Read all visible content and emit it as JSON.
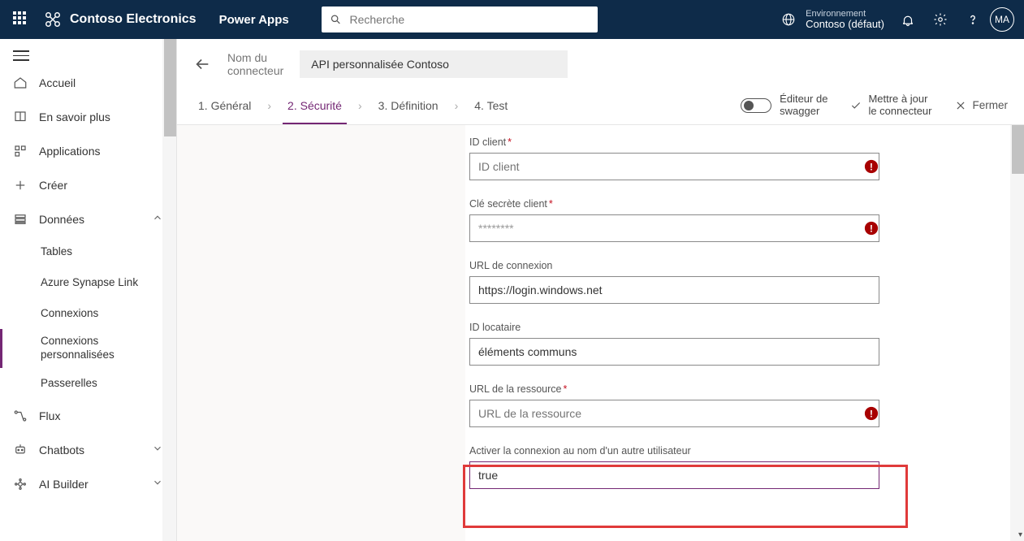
{
  "header": {
    "brand": "Contoso Electronics",
    "product": "Power Apps",
    "search_placeholder": "Recherche",
    "env_label": "Environnement",
    "env_value": "Contoso (défaut)",
    "avatar": "MA"
  },
  "sidebar": {
    "items": [
      {
        "label": "Accueil"
      },
      {
        "label": "En savoir plus"
      },
      {
        "label": "Applications"
      },
      {
        "label": "Créer"
      },
      {
        "label": "Données"
      },
      {
        "label": "Tables"
      },
      {
        "label": "Azure Synapse Link"
      },
      {
        "label": "Connexions"
      },
      {
        "label_line1": "Connexions",
        "label_line2": "personnalisées"
      },
      {
        "label": "Passerelles"
      },
      {
        "label": "Flux"
      },
      {
        "label": "Chatbots"
      },
      {
        "label": "AI Builder"
      }
    ]
  },
  "title": {
    "label_line1": "Nom du",
    "label_line2": "connecteur",
    "value": "API personnalisée Contoso"
  },
  "steps": {
    "s1": "1. Général",
    "s2": "2. Sécurité",
    "s3": "3. Définition",
    "s4": "4. Test",
    "swagger_line1": "Éditeur de",
    "swagger_line2": "swagger",
    "update_line1": "Mettre à jour",
    "update_line2": "le connecteur",
    "close": "Fermer"
  },
  "form": {
    "client_id_label": "ID client",
    "client_id_placeholder": "ID client",
    "client_secret_label": "Clé secrète client",
    "client_secret_value": "********",
    "login_url_label": "URL de connexion",
    "login_url_value": "https://login.windows.net",
    "tenant_id_label": "ID locataire",
    "tenant_id_value": "éléments communs",
    "resource_url_label": "URL de la ressource",
    "resource_url_placeholder": "URL de la ressource",
    "onbehalf_label": "Activer la connexion au nom d'un autre utilisateur",
    "onbehalf_value": "true"
  }
}
